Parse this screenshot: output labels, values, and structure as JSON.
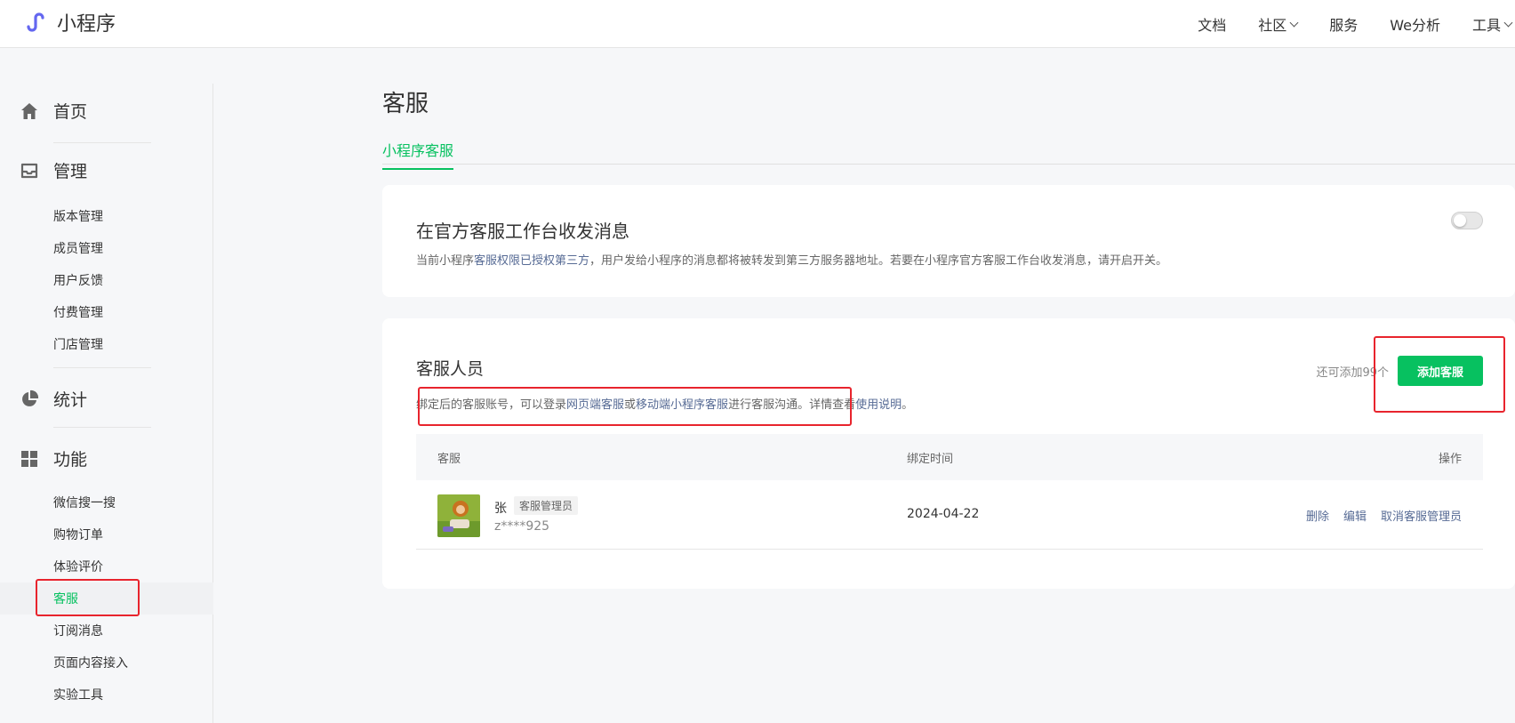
{
  "header": {
    "logo_text": "小程序",
    "nav": [
      {
        "label": "文档",
        "dropdown": false
      },
      {
        "label": "社区",
        "dropdown": true
      },
      {
        "label": "服务",
        "dropdown": false
      },
      {
        "label": "We分析",
        "dropdown": false
      },
      {
        "label": "工具",
        "dropdown": true
      }
    ]
  },
  "sidebar": {
    "sections": [
      {
        "label": "首页",
        "icon": "home-icon",
        "items": []
      },
      {
        "label": "管理",
        "icon": "inbox-icon",
        "items": [
          "版本管理",
          "成员管理",
          "用户反馈",
          "付费管理",
          "门店管理"
        ]
      },
      {
        "label": "统计",
        "icon": "pie-chart-icon",
        "items": []
      },
      {
        "label": "功能",
        "icon": "grid-icon",
        "items": [
          "微信搜一搜",
          "购物订单",
          "体验评价",
          "客服",
          "订阅消息",
          "页面内容接入",
          "实验工具"
        ]
      }
    ],
    "active_item": "客服"
  },
  "main": {
    "title": "客服",
    "tabs": [
      {
        "label": "小程序客服",
        "active": true
      }
    ],
    "official_workbench": {
      "title": "在官方客服工作台收发消息",
      "desc_prefix": "当前小程序",
      "desc_link": "客服权限已授权第三方",
      "desc_suffix": "，用户发给小程序的消息都将被转发到第三方服务器地址。若要在小程序官方客服工作台收发消息，请开启开关。",
      "toggle_on": false
    },
    "staff": {
      "title": "客服人员",
      "desc_1": "绑定后的客服账号，可以登录",
      "link_web": "网页端客服",
      "desc_2": "或",
      "link_mobile": "移动端小程序客服",
      "desc_3": "进行客服沟通。详情查看",
      "link_help": "使用说明",
      "desc_4": "。",
      "quota_text": "还可添加99个",
      "add_button": "添加客服",
      "table": {
        "headers": [
          "客服",
          "绑定时间",
          "操作"
        ],
        "rows": [
          {
            "name": "张",
            "role_badge": "客服管理员",
            "account": "z****925",
            "bind_time": "2024-04-22",
            "actions": [
              "删除",
              "编辑",
              "取消客服管理员"
            ]
          }
        ]
      }
    }
  },
  "colors": {
    "accent": "#07c160",
    "link": "#576b95",
    "highlight": "#e8242d"
  }
}
